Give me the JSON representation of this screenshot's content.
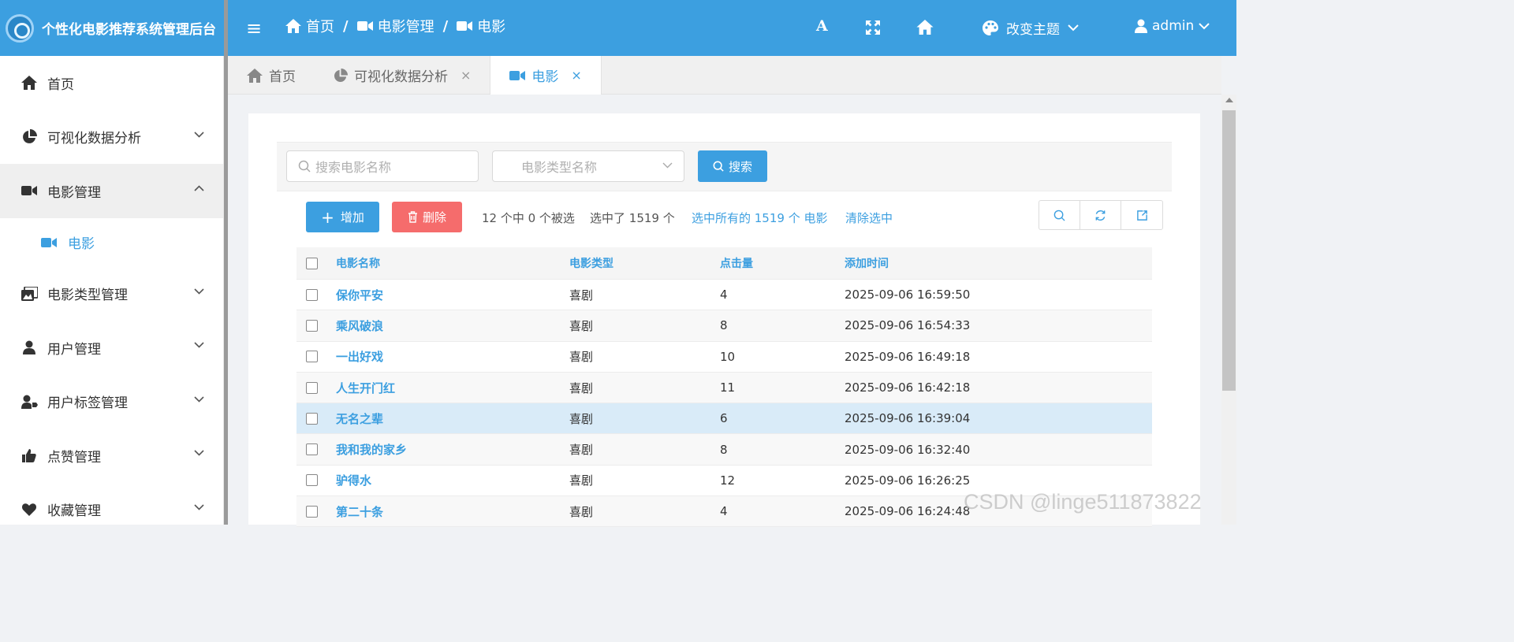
{
  "app": {
    "title": "个性化电影推荐系统管理后台"
  },
  "header": {
    "breadcrumb": [
      "首页",
      "电影管理",
      "电影"
    ],
    "breadcrumb_sep": "/",
    "theme_label": "改变主题",
    "user_label": "admin",
    "font_tool_label": "A"
  },
  "sidebar": {
    "items": [
      {
        "label": "首页",
        "icon": "home-icon"
      },
      {
        "label": "可视化数据分析",
        "icon": "pie-chart-icon"
      },
      {
        "label": "电影管理",
        "icon": "video-camera-icon",
        "expanded": true
      },
      {
        "label": "电影",
        "icon": "video-camera-icon",
        "sub": true,
        "active": true
      },
      {
        "label": "电影类型管理",
        "icon": "images-icon"
      },
      {
        "label": "用户管理",
        "icon": "user-icon"
      },
      {
        "label": "用户标签管理",
        "icon": "user-tag-icon"
      },
      {
        "label": "点赞管理",
        "icon": "thumbs-up-icon"
      },
      {
        "label": "收藏管理",
        "icon": "heart-icon"
      }
    ]
  },
  "tabs": [
    {
      "label": "首页",
      "icon": "home-icon",
      "closable": false
    },
    {
      "label": "可视化数据分析",
      "icon": "pie-chart-icon",
      "closable": true,
      "close": "×"
    },
    {
      "label": "电影",
      "icon": "video-camera-icon",
      "closable": true,
      "active": true,
      "close": "×"
    }
  ],
  "search": {
    "name_placeholder": "搜索电影名称",
    "type_placeholder": "电影类型名称",
    "button_label": "搜索"
  },
  "actions": {
    "add_label": "增加",
    "delete_label": "删除",
    "selection_info": "12 个中 0 个被选    选中了 1519 个",
    "select_all_label": "选中所有的 1519 个 电影",
    "clear_selection_label": "清除选中"
  },
  "table": {
    "columns": [
      "电影名称",
      "电影类型",
      "点击量",
      "添加时间"
    ],
    "rows": [
      {
        "name": "保你平安",
        "type": "喜剧",
        "clicks": "4",
        "time": "2025-09-06 16:59:50"
      },
      {
        "name": "乘风破浪",
        "type": "喜剧",
        "clicks": "8",
        "time": "2025-09-06 16:54:33"
      },
      {
        "name": "一出好戏",
        "type": "喜剧",
        "clicks": "10",
        "time": "2025-09-06 16:49:18"
      },
      {
        "name": "人生开门红",
        "type": "喜剧",
        "clicks": "11",
        "time": "2025-09-06 16:42:18"
      },
      {
        "name": "无名之辈",
        "type": "喜剧",
        "clicks": "6",
        "time": "2025-09-06 16:39:04"
      },
      {
        "name": "我和我的家乡",
        "type": "喜剧",
        "clicks": "8",
        "time": "2025-09-06 16:32:40"
      },
      {
        "name": "驴得水",
        "type": "喜剧",
        "clicks": "12",
        "time": "2025-09-06 16:26:25"
      },
      {
        "name": "第二十条",
        "type": "喜剧",
        "clicks": "4",
        "time": "2025-09-06 16:24:48"
      }
    ]
  },
  "watermark": "CSDN @linge511873822",
  "colors": {
    "primary": "#3c9fe0",
    "danger": "#f56c6c",
    "highlight_row": "#d9ebf8"
  }
}
